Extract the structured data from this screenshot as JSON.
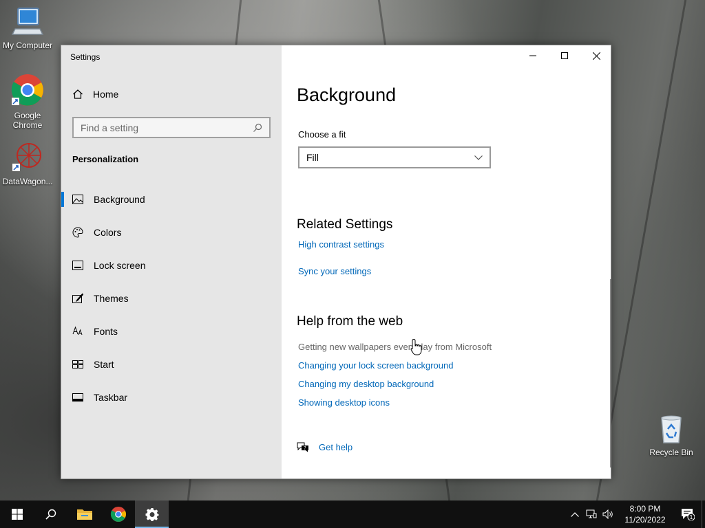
{
  "desktop": {
    "icons": [
      {
        "label": "My Computer"
      },
      {
        "label": "Google Chrome"
      },
      {
        "label": "DataWagon..."
      },
      {
        "label": "Recycle Bin"
      }
    ]
  },
  "window": {
    "title": "Settings",
    "sidebar": {
      "home": "Home",
      "search_placeholder": "Find a setting",
      "section": "Personalization",
      "items": [
        {
          "label": "Background",
          "icon": "picture-icon",
          "active": true
        },
        {
          "label": "Colors",
          "icon": "palette-icon"
        },
        {
          "label": "Lock screen",
          "icon": "lock-screen-icon"
        },
        {
          "label": "Themes",
          "icon": "brush-icon"
        },
        {
          "label": "Fonts",
          "icon": "font-icon"
        },
        {
          "label": "Start",
          "icon": "start-icon"
        },
        {
          "label": "Taskbar",
          "icon": "taskbar-icon"
        }
      ]
    },
    "main": {
      "title": "Background",
      "fit_label": "Choose a fit",
      "fit_value": "Fill",
      "related_heading": "Related Settings",
      "related_links": [
        "High contrast settings",
        "Sync your settings"
      ],
      "help_heading": "Help from the web",
      "help_text": "Getting new wallpapers every day from Microsoft",
      "help_links": [
        "Changing your lock screen background",
        "Changing my desktop background",
        "Showing desktop icons"
      ],
      "get_help": "Get help"
    }
  },
  "taskbar": {
    "time": "8:00 PM",
    "date": "11/20/2022",
    "notification_count": "1",
    "accent": "#0078d7"
  }
}
